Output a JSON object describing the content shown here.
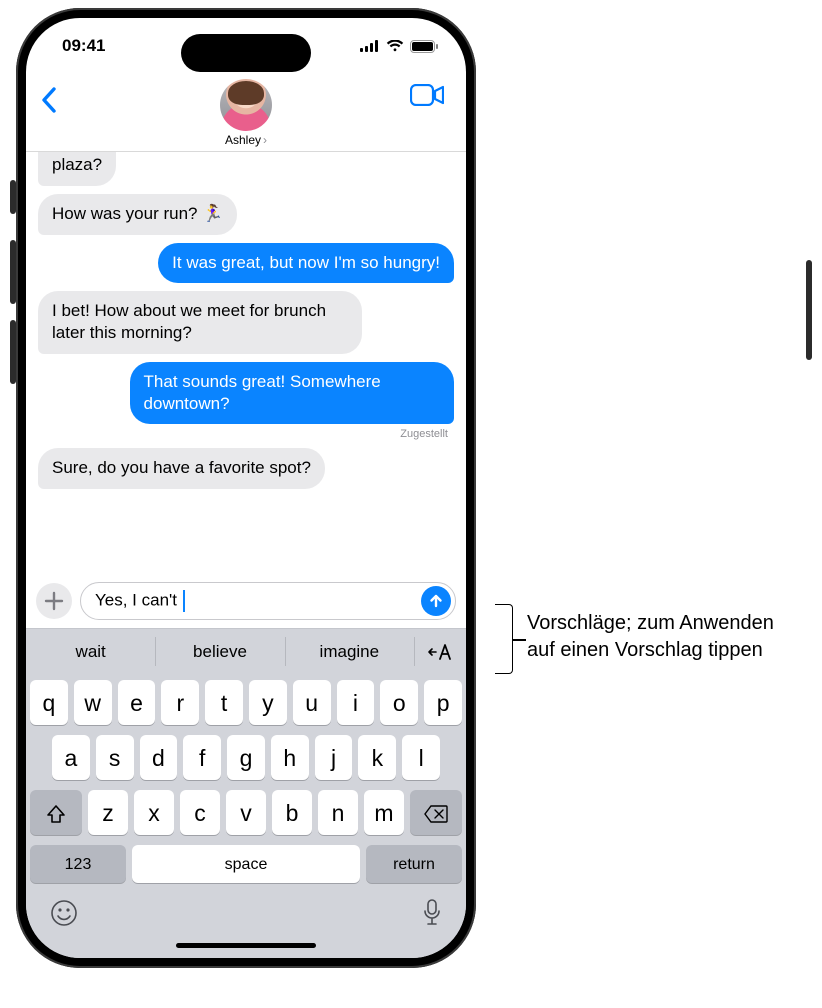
{
  "status": {
    "time": "09:41"
  },
  "contact": {
    "name": "Ashley"
  },
  "messages": {
    "m0": "plaza?",
    "m1": "How was your run? 🏃‍♀️",
    "m2": "It was great, but now I'm so hungry!",
    "m3": "I bet! How about we meet for brunch later this morning?",
    "m4": "That sounds great! Somewhere downtown?",
    "delivered": "Zugestellt",
    "m5": "Sure, do you have a favorite spot?"
  },
  "compose": {
    "text": "Yes, I can't "
  },
  "predictions": {
    "p1": "wait",
    "p2": "believe",
    "p3": "imagine"
  },
  "keyboard": {
    "row1": [
      "q",
      "w",
      "e",
      "r",
      "t",
      "y",
      "u",
      "i",
      "o",
      "p"
    ],
    "row2": [
      "a",
      "s",
      "d",
      "f",
      "g",
      "h",
      "j",
      "k",
      "l"
    ],
    "row3": [
      "z",
      "x",
      "c",
      "v",
      "b",
      "n",
      "m"
    ],
    "numKey": "123",
    "spaceKey": "space",
    "returnKey": "return"
  },
  "callout": {
    "text": "Vorschläge; zum Anwenden auf einen Vorschlag tippen"
  }
}
